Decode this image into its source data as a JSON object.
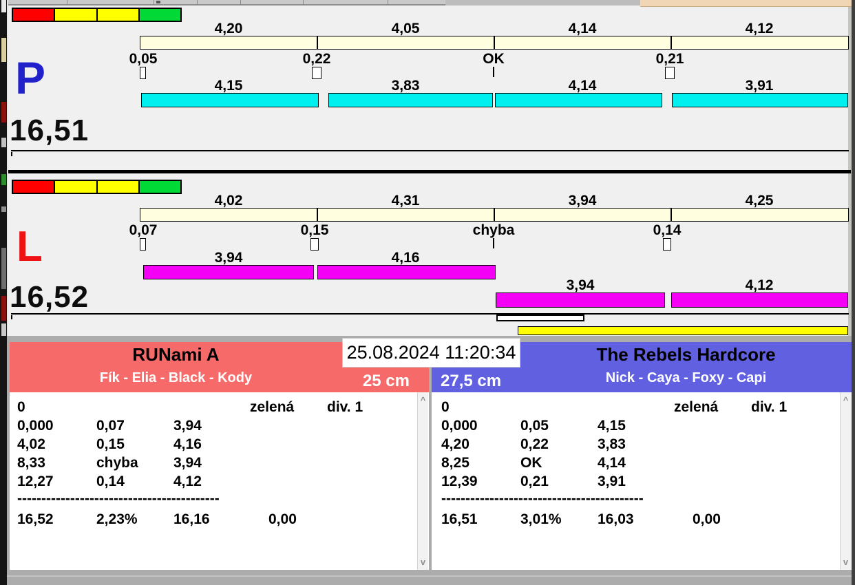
{
  "datetime": "25.08.2024 11:20:34",
  "colors": {
    "traffic_lights": [
      "#FF0000",
      "#FFFF00",
      "#FFFF00",
      "#00D936"
    ],
    "lane_p_dog_bar": "#00F0F0",
    "lane_l_dog_bar": "#F400F4",
    "leg_bar": "#FFFFE0",
    "ready_bar": "#FFFF00",
    "team_left_bg": "#F76A6A",
    "team_right_bg": "#6060E0",
    "lane_p_letter": "#2121CC",
    "lane_l_letter": "#EE1212"
  },
  "lane_p": {
    "letter": "P",
    "total": "16,51",
    "leg_values": [
      "4,20",
      "4,05",
      "4,14",
      "4,12"
    ],
    "cross_values": [
      "0,05",
      "0,22",
      "OK",
      "0,21"
    ],
    "dog_values": [
      "4,15",
      "3,83",
      "4,14",
      "3,91"
    ]
  },
  "lane_l": {
    "letter": "L",
    "total": "16,52",
    "leg_values": [
      "4,02",
      "4,31",
      "3,94",
      "4,25"
    ],
    "cross_values": [
      "0,07",
      "0,15",
      "chyba",
      "0,14"
    ],
    "dog_values_row1": [
      "3,94",
      "4,16"
    ],
    "dog_values_row2": [
      "3,94",
      "4,12"
    ]
  },
  "left_team": {
    "name": "RUNami A",
    "dogs": "Fík - Elia - Black - Kody",
    "jump_height": "25 cm",
    "status_row": {
      "num": "0",
      "light": "zelená",
      "division": "div. 1"
    },
    "runs": [
      [
        "0,000",
        "0,07",
        "3,94"
      ],
      [
        "4,02",
        "0,15",
        "4,16"
      ],
      [
        "8,33",
        "chyba",
        "3,94"
      ],
      [
        "12,27",
        "0,14",
        "4,12"
      ]
    ],
    "separator": "------------------------------------------",
    "totals": [
      "16,52",
      "2,23%",
      "16,16",
      "0,00"
    ]
  },
  "right_team": {
    "name": "The Rebels Hardcore",
    "dogs": "Nick - Caya - Foxy - Capi",
    "jump_height": "27,5 cm",
    "status_row": {
      "num": "0",
      "light": "zelená",
      "division": "div. 1"
    },
    "runs": [
      [
        "0,000",
        "0,05",
        "4,15"
      ],
      [
        "4,20",
        "0,22",
        "3,83"
      ],
      [
        "8,25",
        "OK",
        "4,14"
      ],
      [
        "12,39",
        "0,21",
        "3,91"
      ]
    ],
    "separator": "------------------------------------------",
    "totals": [
      "16,51",
      "3,01%",
      "16,03",
      "0,00"
    ]
  },
  "icons": {
    "scroll_up": "^",
    "scroll_down": "v"
  }
}
